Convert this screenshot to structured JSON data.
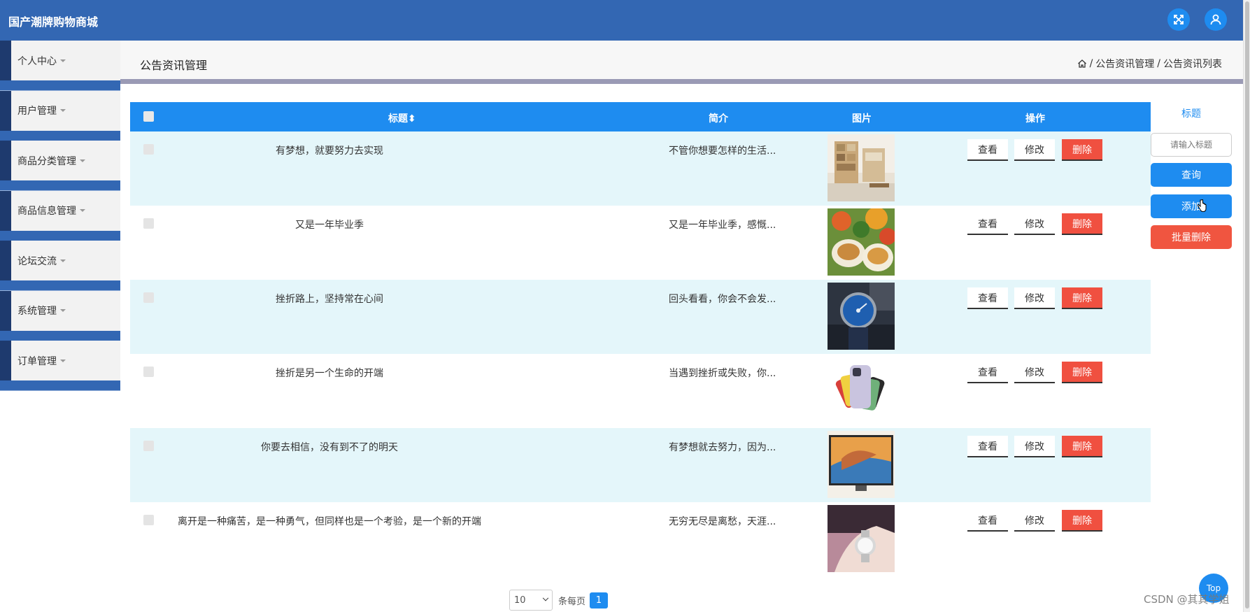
{
  "app": {
    "title": "国产潮牌购物商城"
  },
  "header": {
    "fullscreen_icon": "expand-icon",
    "user_icon": "user-icon"
  },
  "sidebar": {
    "items": [
      {
        "label": "个人中心"
      },
      {
        "label": "用户管理"
      },
      {
        "label": "商品分类管理"
      },
      {
        "label": "商品信息管理"
      },
      {
        "label": "论坛交流"
      },
      {
        "label": "系统管理"
      },
      {
        "label": "订单管理"
      }
    ]
  },
  "page": {
    "title": "公告资讯管理",
    "breadcrumb": [
      "公告资讯管理",
      "公告资讯列表"
    ],
    "breadcrumb_sep": "/"
  },
  "table": {
    "headers": {
      "title": "标题",
      "intro": "简介",
      "image": "图片",
      "actions": "操作"
    },
    "actions": {
      "view": "查看",
      "edit": "修改",
      "delete": "删除"
    },
    "rows": [
      {
        "title": "有梦想，就要努力去实现",
        "intro": "不管你想要怎样的生活...",
        "image": "room-furniture-photo"
      },
      {
        "title": "又是一年毕业季",
        "intro": "又是一年毕业季，感慨...",
        "image": "food-dishes-photo"
      },
      {
        "title": "挫折路上，坚持常在心间",
        "intro": "回头看看，你会不会发...",
        "image": "wristwatch-photo"
      },
      {
        "title": "挫折是另一个生命的开端",
        "intro": "当遇到挫折或失败，你...",
        "image": "smartphones-photo"
      },
      {
        "title": "你要去相信，没有到不了的明天",
        "intro": "有梦想就去努力，因为...",
        "image": "tv-screen-photo"
      },
      {
        "title": "离开是一种痛苦，是一种勇气，但同样也是一个考验，是一个新的开端",
        "intro": "无穷无尽是离愁，天涯...",
        "image": "hand-watch-photo"
      }
    ]
  },
  "search": {
    "label": "标题",
    "placeholder": "请输入标题",
    "query_label": "查询",
    "add_label": "添加",
    "batch_delete_label": "批量删除"
  },
  "pagination": {
    "page_size": "10",
    "per_page_label": "条每页",
    "current_page": "1"
  },
  "misc": {
    "top_label": "Top",
    "watermark": "CSDN @其其学姐"
  },
  "colors": {
    "header": "#3367b3",
    "primary": "#1e8cf0",
    "danger": "#f05040",
    "row_alt": "#e4f6fa"
  }
}
